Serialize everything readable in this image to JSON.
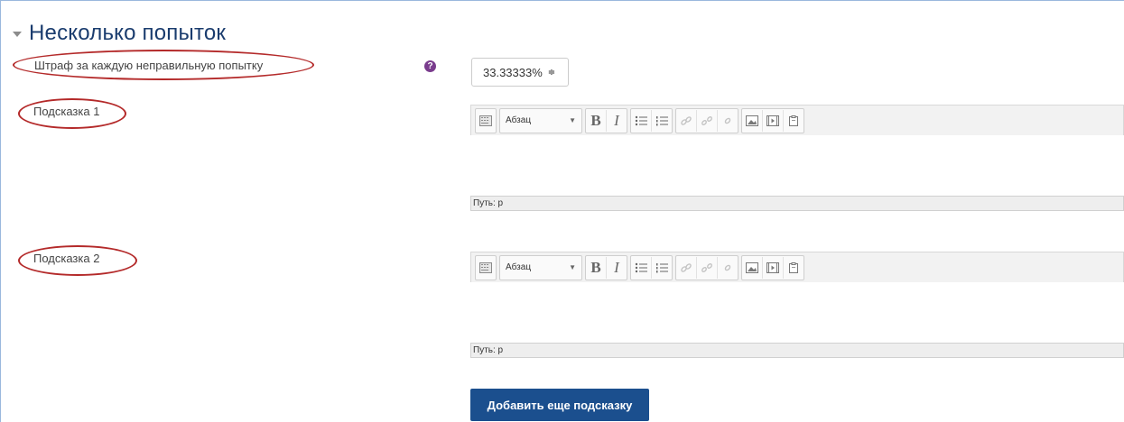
{
  "section": {
    "title": "Несколько попыток"
  },
  "penalty": {
    "label": "Штраф за каждую неправильную попытку",
    "help": "?",
    "value": "33.33333%",
    "arrows": "≑"
  },
  "hints": [
    {
      "label": "Подсказка 1",
      "format": "Абзац",
      "path": "Путь: p"
    },
    {
      "label": "Подсказка 2",
      "format": "Абзац",
      "path": "Путь: p"
    }
  ],
  "toolbar": {
    "bold": "B",
    "italic": "I"
  },
  "add_hint_button": "Добавить еще подсказку",
  "colors": {
    "title": "#1a3c6e",
    "annotation": "#b42a2a",
    "button": "#1b4f8e",
    "help": "#7a3c8d"
  }
}
